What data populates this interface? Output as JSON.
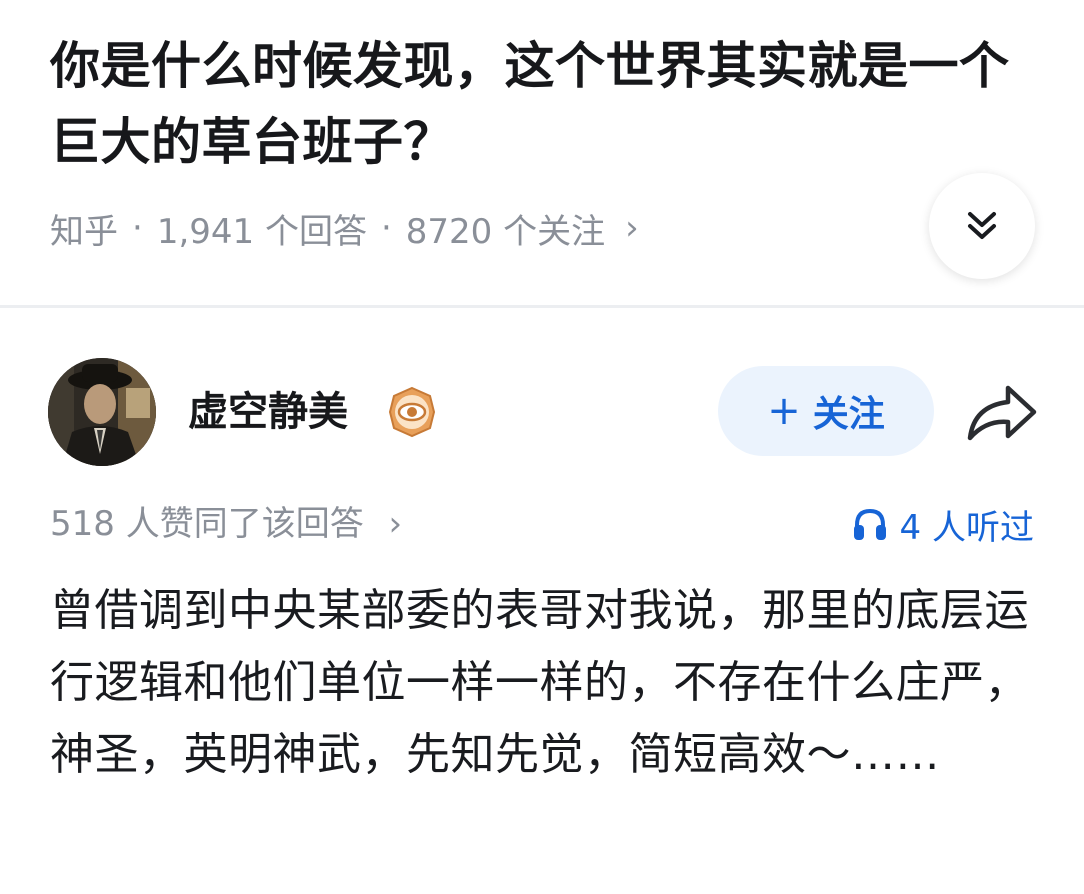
{
  "question": {
    "title": "你是什么时候发现，这个世界其实就是一个巨大的草台班子？",
    "source": "知乎",
    "answers": "1,941 个回答",
    "followers": "8720 个关注",
    "separator": "·",
    "chevron": "›",
    "expand_icon": "double-chevron-down-icon"
  },
  "author": {
    "name": "虚空静美",
    "avatar_icon": "avatar",
    "badge_icon": "eye-badge-icon",
    "follow_label": "关注",
    "follow_plus": "+",
    "share_icon": "share-icon",
    "accent": "#1764d6",
    "follow_bg": "#ebf3fd"
  },
  "stats": {
    "votes": "518 人赞同了该回答",
    "votes_chevron": "›",
    "listens": "4 人听过",
    "listen_icon": "headphones-icon"
  },
  "answer": {
    "text": "曾借调到中央某部委的表哥对我说，那里的底层运行逻辑和他们单位一样一样的，不存在什么庄严，神圣，英明神武，先知先觉，简短高效～……"
  }
}
